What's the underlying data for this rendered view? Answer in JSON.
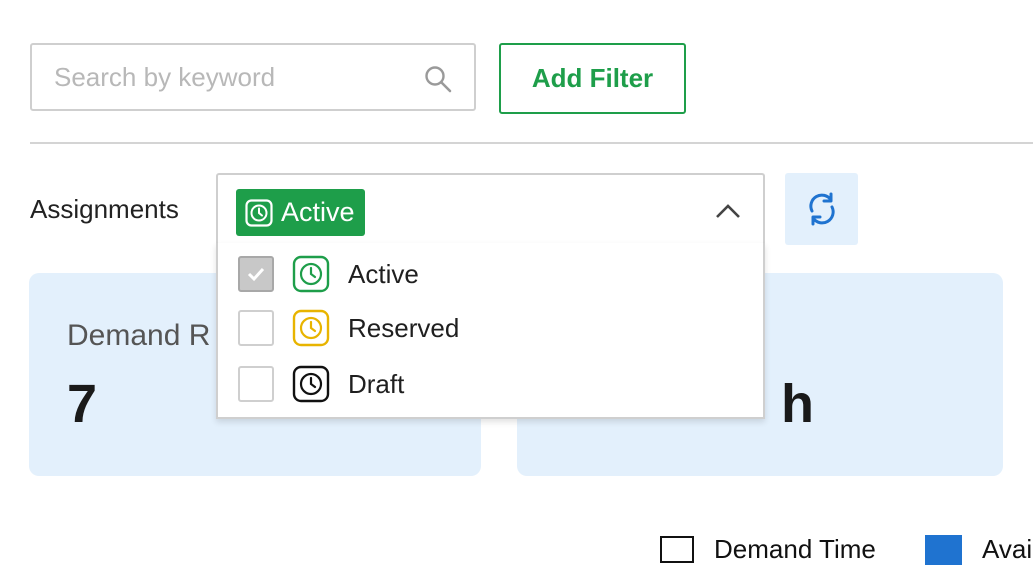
{
  "search": {
    "placeholder": "Search by keyword",
    "value": ""
  },
  "add_filter_label": "Add Filter",
  "assignments": {
    "label": "Assignments",
    "selected_chip": "Active",
    "options": [
      {
        "label": "Active",
        "checked": true,
        "color": "#1e9e4a"
      },
      {
        "label": "Reserved",
        "checked": false,
        "color": "#e8b400"
      },
      {
        "label": "Draft",
        "checked": false,
        "color": "#111111"
      }
    ]
  },
  "cards": [
    {
      "label": "Demand R",
      "value": "7"
    },
    {
      "label": "",
      "value": "h"
    }
  ],
  "legend": [
    {
      "label": "Demand Time",
      "color": "#ffffff"
    },
    {
      "label": "Avai",
      "color": "#1f73d0"
    }
  ],
  "colors": {
    "accent": "#1e9e4a",
    "card_bg": "#e3f0fc",
    "refresh": "#1f73d0"
  }
}
